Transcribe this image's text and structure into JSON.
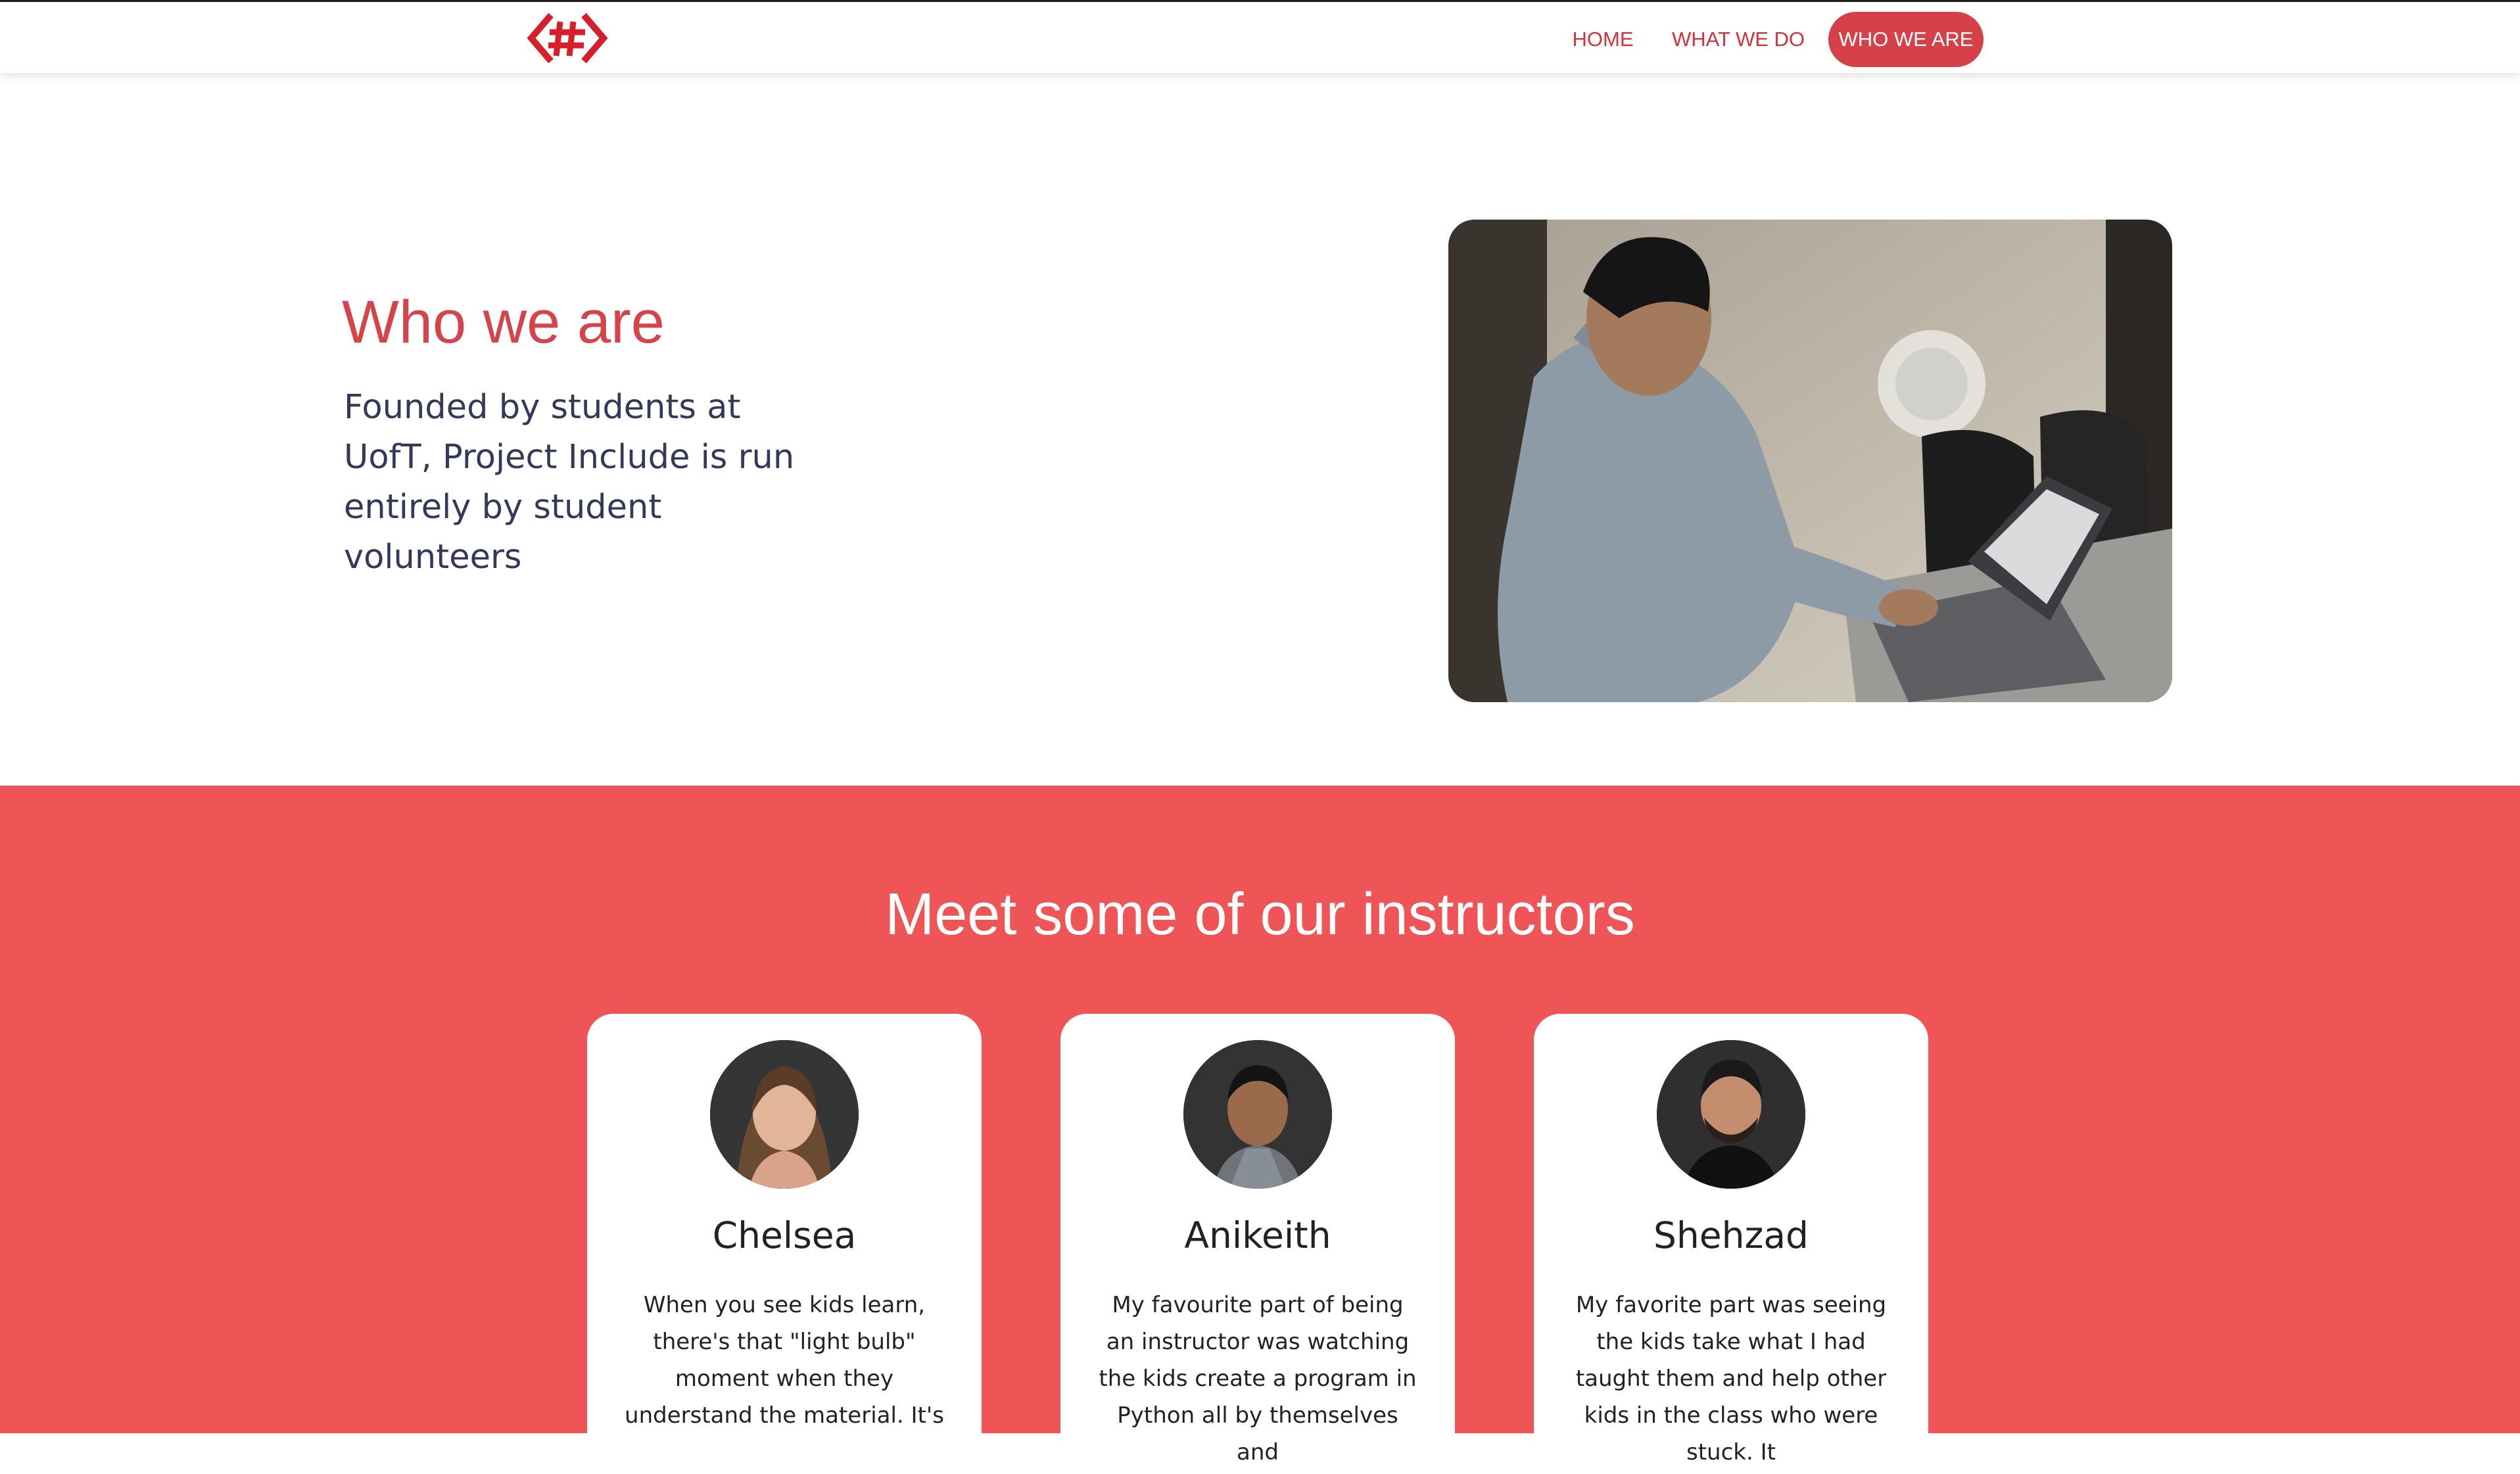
{
  "nav": {
    "logo_alt": "hash-logo",
    "links": [
      {
        "label": "HOME",
        "active": false
      },
      {
        "label": "WHAT WE DO",
        "active": false
      },
      {
        "label": "WHO WE ARE",
        "active": true
      }
    ]
  },
  "hero": {
    "title": "Who we are",
    "description": "Founded by students at UofT, Project Include is run entirely by student volunteers",
    "image": "photo-student-typing-on-laptop"
  },
  "instructors": {
    "title": "Meet some of our instructors",
    "cards": [
      {
        "name": "Chelsea",
        "quote": "When you see kids learn, there's that \"light bulb\" moment when they understand the material. It's",
        "avatar": "avatar-chelsea"
      },
      {
        "name": "Anikeith",
        "quote": "My favourite part of being an instructor was watching the kids create a program in Python all by themselves and",
        "avatar": "avatar-anikeith"
      },
      {
        "name": "Shehzad",
        "quote": "My favorite part was seeing the kids take what I had taught them and help other kids in the class who were stuck. It",
        "avatar": "avatar-shehzad"
      }
    ]
  },
  "colors": {
    "brand_red": "#d5444a",
    "section_red": "#ef5557",
    "active_pill": "#d54049",
    "body_text": "#33395a"
  }
}
